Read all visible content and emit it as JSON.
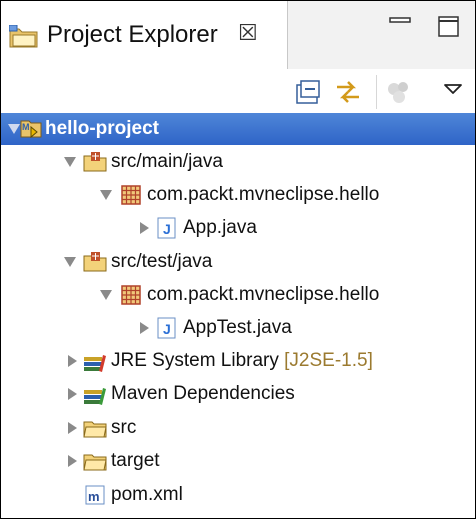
{
  "tab": {
    "title": "Project Explorer",
    "close_glyph": "☒"
  },
  "tree": [
    {
      "label": "hello-project",
      "icon": "maven-project-icon",
      "expanded": true,
      "selected": true
    },
    {
      "label": "src/main/java",
      "icon": "source-folder-icon",
      "expanded": true
    },
    {
      "label": "com.packt.mvneclipse.hello",
      "icon": "package-icon",
      "expanded": true
    },
    {
      "label": "App.java",
      "icon": "java-file-icon",
      "expanded": false
    },
    {
      "label": "src/test/java",
      "icon": "source-folder-icon",
      "expanded": true
    },
    {
      "label": "com.packt.mvneclipse.hello",
      "icon": "package-icon",
      "expanded": true
    },
    {
      "label": "AppTest.java",
      "icon": "java-file-icon",
      "expanded": false
    },
    {
      "label": "JRE System Library",
      "decoration": "[J2SE-1.5]",
      "icon": "library-icon",
      "expanded": false
    },
    {
      "label": "Maven Dependencies",
      "icon": "library-icon",
      "expanded": false
    },
    {
      "label": "src",
      "icon": "folder-icon",
      "expanded": false
    },
    {
      "label": "target",
      "icon": "folder-icon",
      "expanded": false
    },
    {
      "label": "pom.xml",
      "icon": "maven-pom-icon"
    }
  ],
  "colors": {
    "selection": "#3a6fd0",
    "decoration": "#9b7a2f",
    "package": "#b0422a",
    "java": "#2a6fd6"
  }
}
